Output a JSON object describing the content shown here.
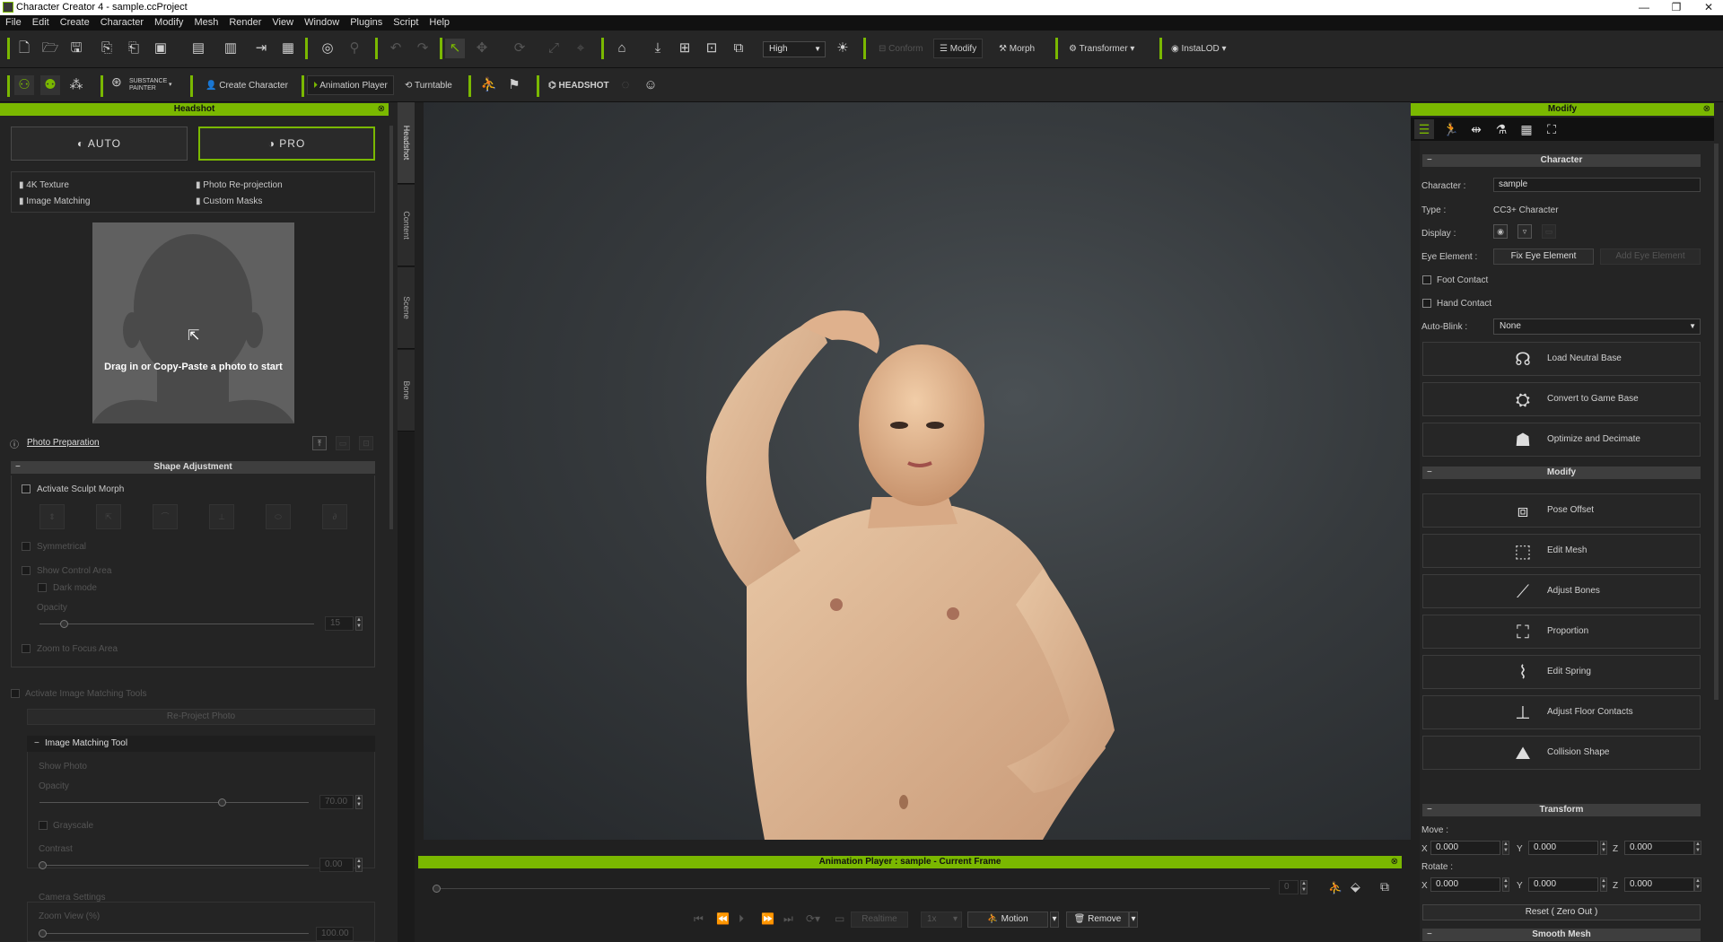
{
  "window": {
    "title": "Character Creator 4 - sample.ccProject",
    "controls": [
      "—",
      "❐",
      "✕"
    ]
  },
  "menu": [
    "File",
    "Edit",
    "Create",
    "Character",
    "Modify",
    "Mesh",
    "Render",
    "View",
    "Window",
    "Plugins",
    "Script",
    "Help"
  ],
  "toolbar1": {
    "quality_select": "High",
    "conform_label": "Conform",
    "modify_label": "Modify",
    "morph_label": "Morph",
    "transformer_label": "Transformer",
    "instalod_label": "InstaLOD"
  },
  "toolbar2": {
    "substance_label_top": "SUBSTANCE",
    "substance_label_bottom": "PAINTER",
    "create_character_label": "Create Character",
    "animation_player_label": "Animation Player",
    "turntable_label": "Turntable",
    "headshot_label": "HEADSHOT"
  },
  "headshot_panel": {
    "title": "Headshot",
    "auto_label": "AUTO",
    "pro_label": "PRO",
    "features": [
      "4K Texture",
      "Photo Re-projection",
      "Image Matching",
      "Custom Masks"
    ],
    "drop_text": "Drag in or Copy-Paste a photo to start",
    "photo_prep_label": "Photo Preparation",
    "shape_adjustment_title": "Shape Adjustment",
    "activate_sculpt_morph": "Activate Sculpt Morph",
    "symmetrical": "Symmetrical",
    "show_control_area": "Show Control Area",
    "dark_mode": "Dark mode",
    "opacity_label": "Opacity",
    "opacity_value": "15",
    "zoom_focus": "Zoom to Focus Area",
    "activate_image_matching": "Activate Image Matching Tools",
    "reproject_label": "Re-Project Photo",
    "image_matching_tool_title": "Image Matching Tool",
    "show_photo": "Show Photo",
    "opacity2_label": "Opacity",
    "opacity2_value": "70.00",
    "grayscale": "Grayscale",
    "contrast_label": "Contrast",
    "contrast_value": "0.00",
    "camera_settings": "Camera Settings",
    "zoom_view_label": "Zoom View (%)",
    "zoom_view_value": "100.00"
  },
  "side_tabs": [
    "Headshot",
    "Content",
    "Scene",
    "Bone"
  ],
  "modify_panel": {
    "title": "Modify",
    "character_section": "Character",
    "character_label": "Character :",
    "character_value": "sample",
    "type_label": "Type :",
    "type_value": "CC3+ Character",
    "display_label": "Display :",
    "eye_element_label": "Eye Element :",
    "fix_eye_label": "Fix Eye Element",
    "add_eye_label": "Add Eye Element",
    "foot_contact": "Foot Contact",
    "hand_contact": "Hand Contact",
    "auto_blink_label": "Auto-Blink :",
    "auto_blink_value": "None",
    "load_neutral": "Load Neutral Base",
    "convert_game": "Convert to Game Base",
    "optimize": "Optimize and Decimate",
    "modify_section": "Modify",
    "pose_offset": "Pose Offset",
    "edit_mesh": "Edit Mesh",
    "adjust_bones": "Adjust Bones",
    "proportion": "Proportion",
    "edit_spring": "Edit Spring",
    "adjust_floor": "Adjust Floor Contacts",
    "collision_shape": "Collision Shape",
    "transform_section": "Transform",
    "move_label": "Move :",
    "rotate_label": "Rotate :",
    "axis_x": "X",
    "axis_y": "Y",
    "axis_z": "Z",
    "move_x": "0.000",
    "move_y": "0.000",
    "move_z": "0.000",
    "rot_x": "0.000",
    "rot_y": "0.000",
    "rot_z": "0.000",
    "reset_label": "Reset ( Zero Out )",
    "smooth_mesh_section": "Smooth Mesh"
  },
  "animation_player": {
    "title": "Animation Player : sample - Current Frame",
    "frame_value": "0",
    "realtime_label": "Realtime",
    "speed_value": "1x",
    "motion_label": "Motion",
    "remove_label": "Remove"
  },
  "colors": {
    "accent": "#7ab800",
    "panel_bg": "#242424",
    "viewport_bg": "#2f3336"
  }
}
